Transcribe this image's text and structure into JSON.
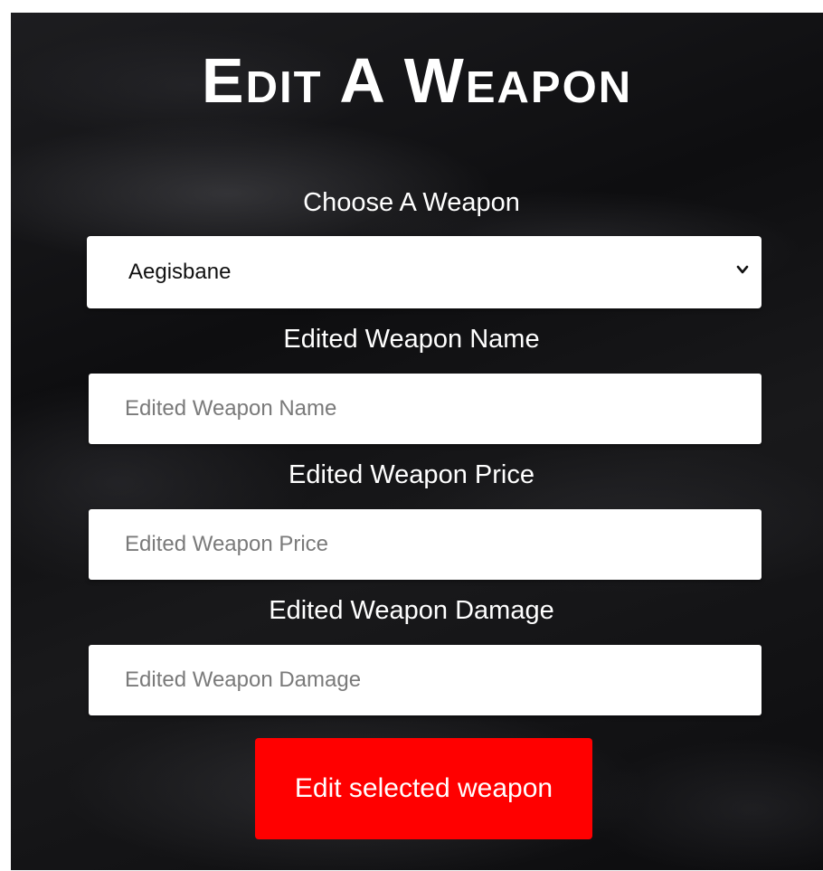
{
  "page": {
    "title": "Edit A Weapon"
  },
  "form": {
    "choose_label": "Choose A Weapon",
    "weapon_select": {
      "selected": "Aegisbane",
      "icon": "chevron-down-icon"
    },
    "name_label": "Edited Weapon Name",
    "name_placeholder": "Edited Weapon Name",
    "price_label": "Edited Weapon Price",
    "price_placeholder": "Edited Weapon Price",
    "damage_label": "Edited Weapon Damage",
    "damage_placeholder": "Edited Weapon Damage",
    "submit_label": "Edit selected weapon"
  },
  "colors": {
    "button": "#ff0000",
    "text": "#ffffff",
    "background": "#121214"
  }
}
